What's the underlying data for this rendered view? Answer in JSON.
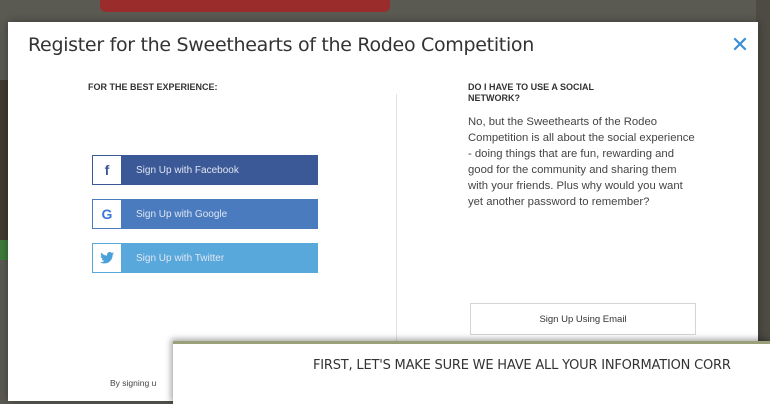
{
  "modal": {
    "title": "Register for the Sweethearts of the Rodeo Competition",
    "close_symbol": "✕"
  },
  "left": {
    "heading": "FOR THE BEST EXPERIENCE:",
    "buttons": [
      {
        "label": "Sign Up with Facebook",
        "icon": "facebook-icon",
        "glyph": "f",
        "color": "#3b5897"
      },
      {
        "label": "Sign Up with Google",
        "icon": "google-icon",
        "glyph": "G",
        "color": "#4a7bbf"
      },
      {
        "label": "Sign Up with Twitter",
        "icon": "twitter-icon",
        "glyph": "🐦",
        "color": "#58a8dc"
      }
    ],
    "footer_text": "By signing u"
  },
  "right": {
    "heading": "DO I HAVE TO USE A SOCIAL NETWORK?",
    "body": "No, but the Sweethearts of the Rodeo Competition is all about the social experience - doing things that are fun, rewarding and good for the community and sharing them with your friends. Plus why would you want yet another password to remember?",
    "email_button": "Sign Up Using Email"
  },
  "overlay": {
    "text": "FIRST, LET'S MAKE SURE WE HAVE ALL YOUR INFORMATION CORR"
  }
}
